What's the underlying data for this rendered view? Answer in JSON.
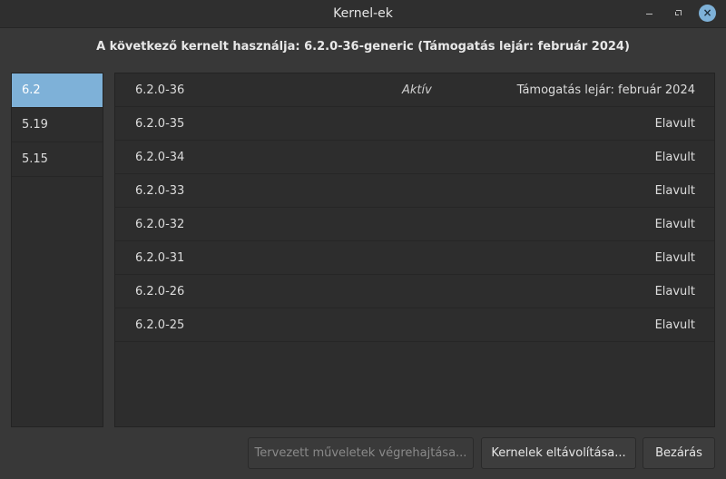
{
  "window": {
    "title": "Kernel-ek"
  },
  "header": {
    "text": "A következő kernelt használja: 6.2.0-36-generic (Támogatás lejár: február 2024)"
  },
  "sidebar": {
    "items": [
      {
        "label": "6.2",
        "selected": true
      },
      {
        "label": "5.19"
      },
      {
        "label": "5.15"
      }
    ]
  },
  "kernels": [
    {
      "version": "6.2.0-36",
      "state": "Aktív",
      "support": "Támogatás lejár: február 2024"
    },
    {
      "version": "6.2.0-35",
      "state": "",
      "support": "Elavult"
    },
    {
      "version": "6.2.0-34",
      "state": "",
      "support": "Elavult"
    },
    {
      "version": "6.2.0-33",
      "state": "",
      "support": "Elavult"
    },
    {
      "version": "6.2.0-32",
      "state": "",
      "support": "Elavult"
    },
    {
      "version": "6.2.0-31",
      "state": "",
      "support": "Elavult"
    },
    {
      "version": "6.2.0-26",
      "state": "",
      "support": "Elavult"
    },
    {
      "version": "6.2.0-25",
      "state": "",
      "support": "Elavult"
    }
  ],
  "buttons": {
    "execute": "Tervezett műveletek végrehajtása...",
    "remove": "Kernelek eltávolítása...",
    "close": "Bezárás"
  },
  "colors": {
    "accent": "#7eb1d8"
  }
}
